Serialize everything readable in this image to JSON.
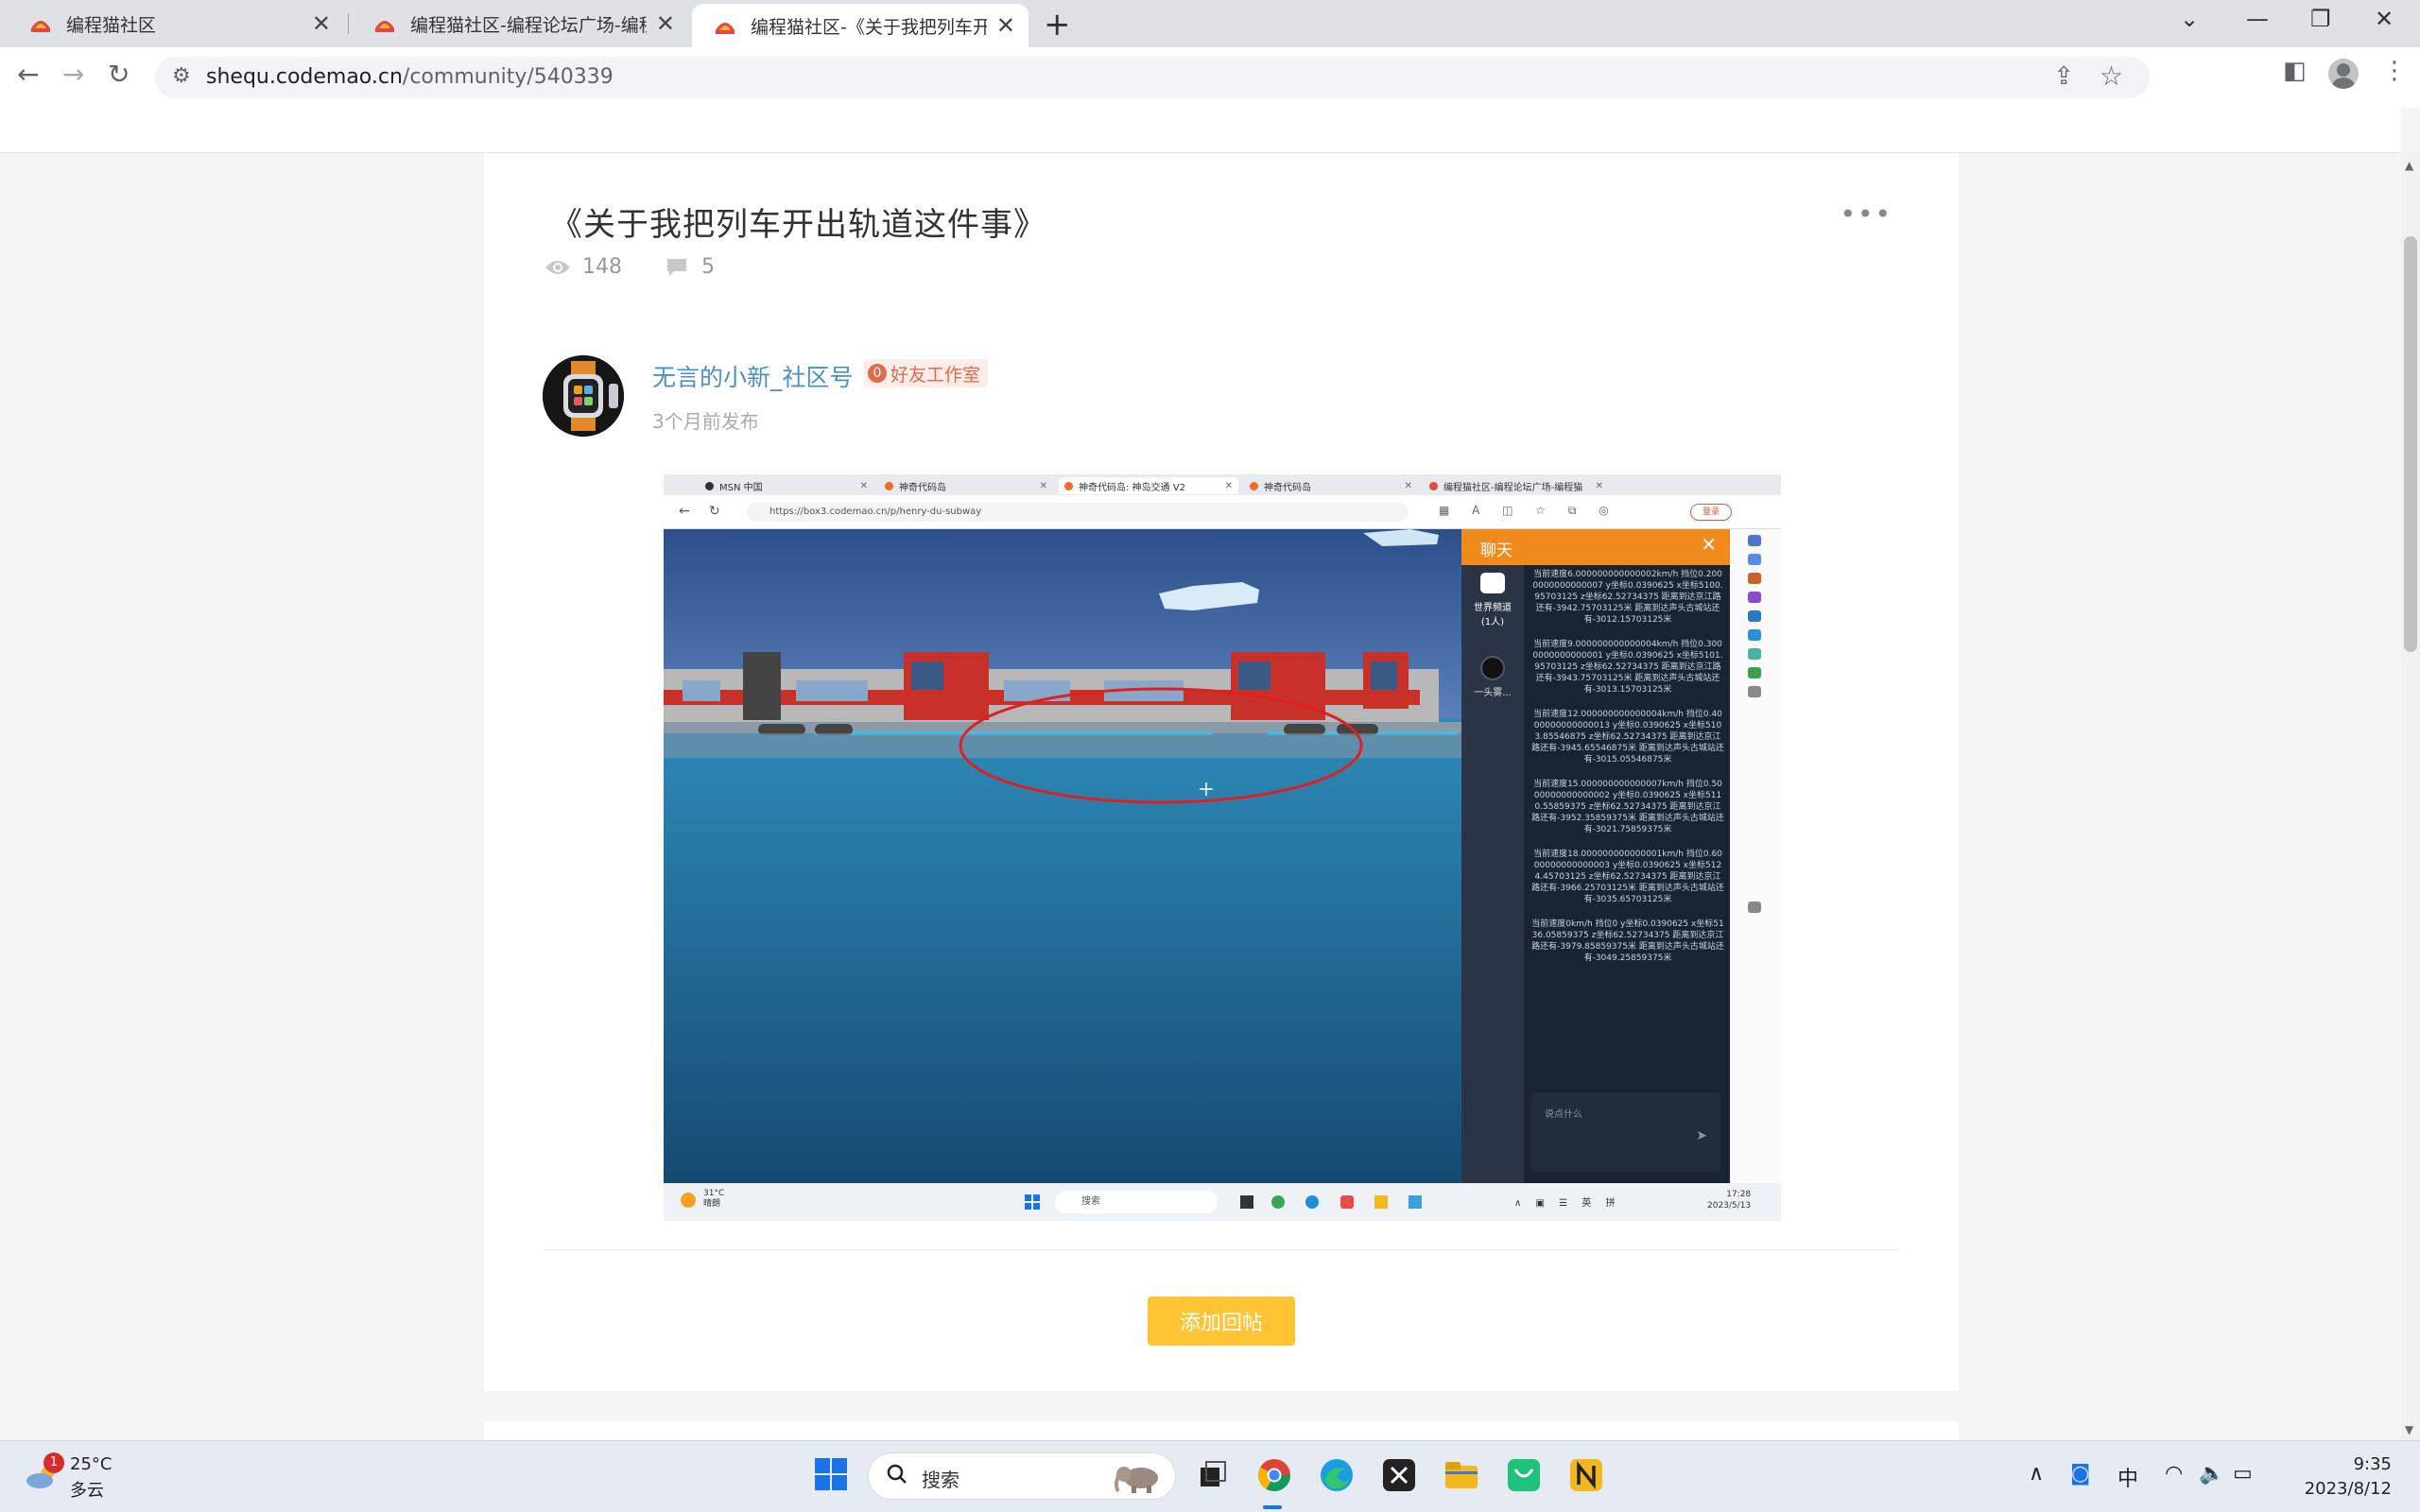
{
  "browser": {
    "tabs": [
      {
        "title": "编程猫社区"
      },
      {
        "title": "编程猫社区-编程论坛广场-编程猫"
      },
      {
        "title": "编程猫社区-《关于我把列车开出"
      }
    ],
    "url_host": "shequ.codemao.cn",
    "url_path": "/community/540339"
  },
  "post": {
    "title": "《关于我把列车开出轨道这件事》",
    "views": "148",
    "comments": "5",
    "author": "无言的小新_社区号",
    "badge_num": "0",
    "badge_label": "好友工作室",
    "time": "3个月前发布",
    "reply_button": "添加回帖"
  },
  "shot": {
    "tabs": [
      "MSN 中国",
      "神奇代码岛",
      "神奇代码岛: 神岛交通 V2",
      "神奇代码岛",
      "编程猫社区-编程论坛广场-编程猫"
    ],
    "url": "https://box3.codemao.cn/p/henry-du-subway",
    "login": "登录",
    "chat_title": "聊天",
    "channel_name": "世界频道",
    "channel_count": "(1人)",
    "user_label": "一头雾...",
    "messages": [
      "当前速度6.000000000000002km/h 挡位0.2000000000000007 y坐标0.0390625 x坐标5100.95703125 z坐标62.52734375 距离到达京江路还有-3942.75703125米 距离到达声头古城站还有-3012.15703125米",
      "当前速度9.000000000000004km/h 挡位0.3000000000000001 y坐标0.0390625 x坐标5101.95703125 z坐标62.52734375 距离到达京江路还有-3943.75703125米 距离到达声头古城站还有-3013.15703125米",
      "当前速度12.000000000000004km/h 挡位0.4000000000000013 y坐标0.0390625 x坐标5103.85546875 z坐标62.52734375 距离到达京江路还有-3945.65546875米 距离到达声头古城站还有-3015.05546875米",
      "当前速度15.000000000000007km/h 挡位0.5000000000000002 y坐标0.0390625 x坐标5110.55859375 z坐标62.52734375 距离到达京江路还有-3952.35859375米 距离到达声头古城站还有-3021.75859375米",
      "当前速度18.000000000000001km/h 挡位0.6000000000000003 y坐标0.0390625 x坐标5124.45703125 z坐标62.52734375 距离到达京江路还有-3966.25703125米 距离到达声头古城站还有-3035.65703125米",
      "当前速度0km/h 挡位0 y坐标0.0390625 x坐标5136.05859375 z坐标62.52734375 距离到达京江路还有-3979.85859375米 距离到达声头古城站还有-3049.25859375米"
    ],
    "input_placeholder": "说点什么",
    "weather_temp": "31°C",
    "weather_cond": "晴朗",
    "search": "搜索",
    "tray": "英 拼",
    "time": "17:28",
    "date": "2023/5/13"
  },
  "taskbar": {
    "notif_count": "1",
    "temp": "25°C",
    "cond": "多云",
    "search": "搜索",
    "ime": "中",
    "time": "9:35",
    "date": "2023/8/12"
  },
  "colors": {
    "accent_link": "#4a90c8",
    "reply_button": "#fec433",
    "chat_header": "#f08a1c",
    "badge": "#e06a4a"
  }
}
